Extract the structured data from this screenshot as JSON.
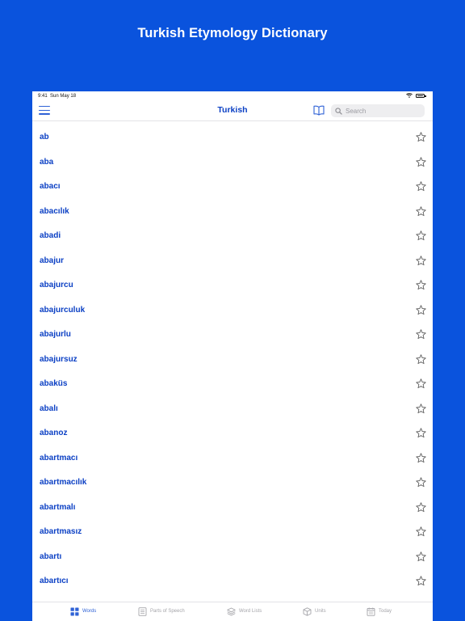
{
  "promo": {
    "title": "Turkish Etymology Dictionary"
  },
  "status": {
    "time": "9:41",
    "date": "Sun May 18"
  },
  "nav": {
    "title": "Turkish",
    "search_placeholder": "Search"
  },
  "words": [
    "ab",
    "aba",
    "abacı",
    "abacılık",
    "abadi",
    "abajur",
    "abajurcu",
    "abajurculuk",
    "abajurlu",
    "abajursuz",
    "abaküs",
    "abalı",
    "abanoz",
    "abartmacı",
    "abartmacılık",
    "abartmalı",
    "abartmasız",
    "abartı",
    "abartıcı"
  ],
  "tabs": [
    {
      "label": "Words",
      "icon": "grid-icon",
      "active": true
    },
    {
      "label": "Parts of Speech",
      "icon": "book-stack-icon",
      "active": false
    },
    {
      "label": "Word Lists",
      "icon": "layers-icon",
      "active": false
    },
    {
      "label": "Units",
      "icon": "cube-icon",
      "active": false
    },
    {
      "label": "Today",
      "icon": "calendar-icon",
      "active": false
    }
  ],
  "colors": {
    "background": "#0a53dd",
    "accent": "#0a3fc4",
    "tab_active": "#2f62d6",
    "tab_inactive": "#a5a5aa"
  }
}
